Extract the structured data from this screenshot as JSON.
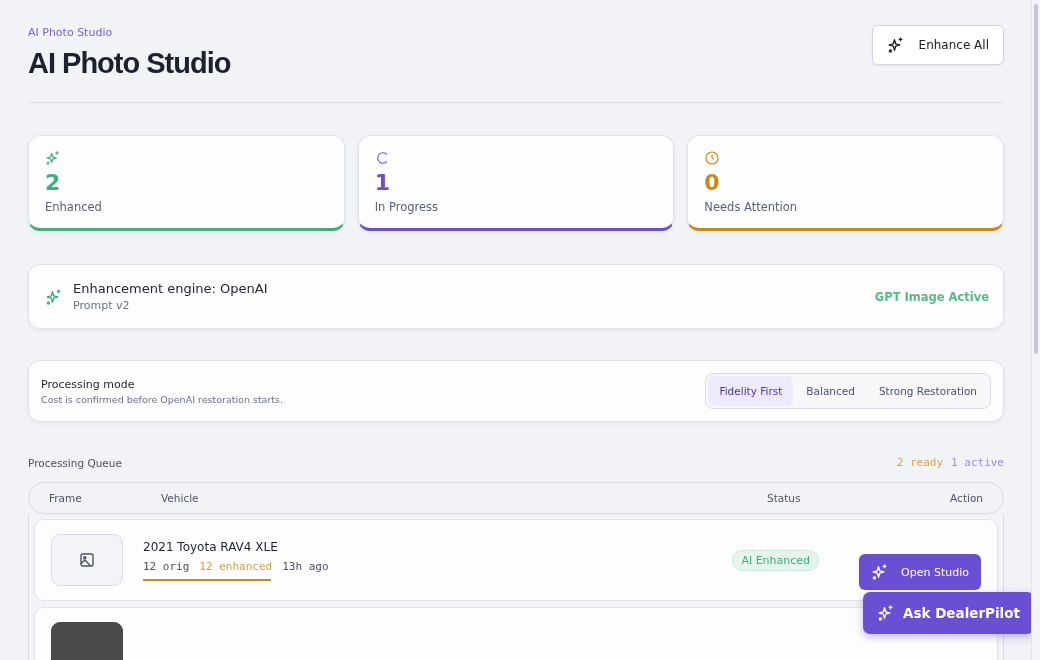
{
  "header": {
    "eyebrow": "AI Photo Studio",
    "title": "AI Photo Studio",
    "action": "Enhance All"
  },
  "stats": [
    {
      "kind": "sparkle",
      "value": "2",
      "label": "Enhanced",
      "color": "#3fae7a"
    },
    {
      "kind": "spinner",
      "value": "1",
      "label": "In Progress",
      "color": "#6a4fd0"
    },
    {
      "kind": "clock",
      "value": "0",
      "label": "Needs Attention",
      "color": "#c98a1a"
    }
  ],
  "engine": {
    "title": "Enhancement engine: OpenAI",
    "subtitle": "Prompt v2",
    "status": "GPT Image Active"
  },
  "mode": {
    "title": "Processing mode",
    "note": "Cost is confirmed before OpenAI restoration starts.",
    "options": [
      {
        "label": "Fidelity First",
        "selected": true
      },
      {
        "label": "Balanced",
        "selected": false
      },
      {
        "label": "Strong Restoration",
        "selected": false
      }
    ]
  },
  "queue": {
    "title": "Processing Queue",
    "ready": "2 ready",
    "active": "1 active",
    "columns": [
      "Frame",
      "Vehicle",
      "Status",
      "Action"
    ],
    "rows": [
      {
        "vehicle": "2021 Toyota RAV4 XLE",
        "orig": "12 orig",
        "enhanced": "12 enhanced",
        "time": "13h ago",
        "status": "AI Enhanced",
        "action": "Open Studio",
        "kind": "placeholder"
      },
      {
        "kind": "dark"
      }
    ]
  },
  "assistant": {
    "label": "Ask DealerPilot"
  }
}
